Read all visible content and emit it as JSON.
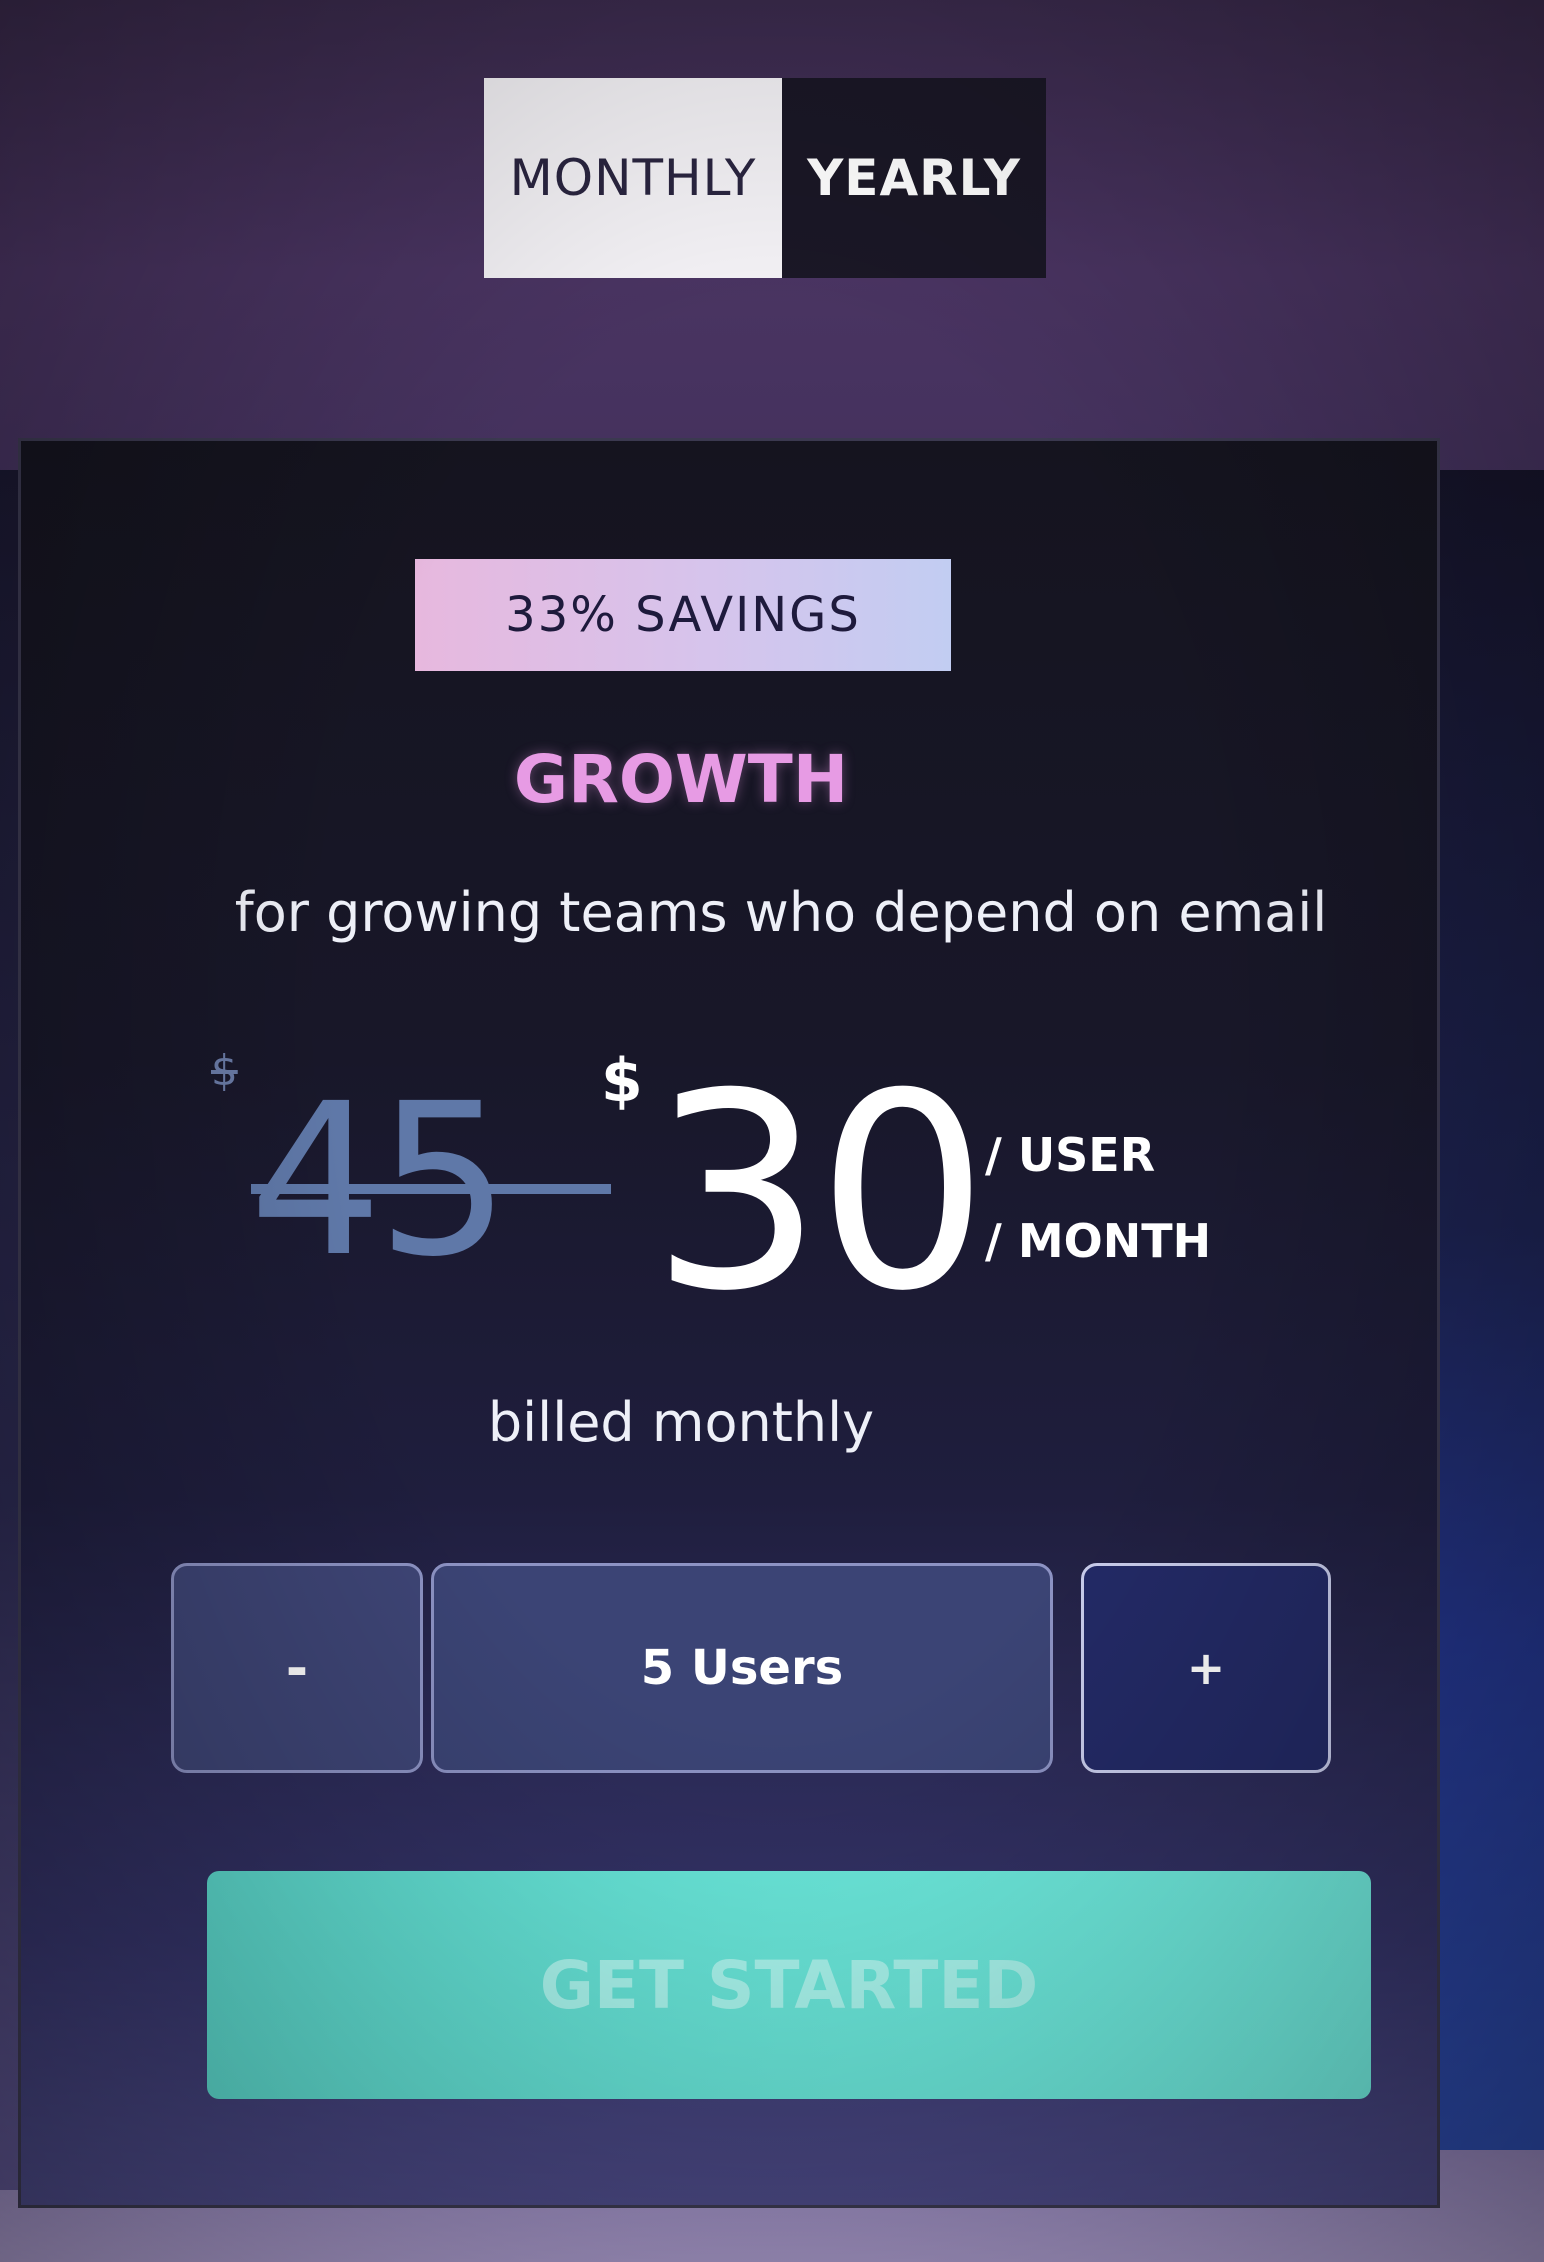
{
  "billing_toggle": {
    "monthly_label": "MONTHLY",
    "yearly_label": "YEARLY",
    "selected": "MONTHLY"
  },
  "plan": {
    "badge": "33% SAVINGS",
    "name": "GROWTH",
    "description": "for growing teams who depend on email",
    "old_currency": "$",
    "old_price": "45",
    "currency": "$",
    "price": "30",
    "per_user": "/ USER",
    "per_month": "/ MONTH",
    "billing_note": "billed monthly"
  },
  "users_stepper": {
    "decrement_label": "-",
    "value": "5 Users",
    "increment_label": "+"
  },
  "cta": {
    "label": "GET STARTED"
  },
  "colors": {
    "plan_name": "#e79be4",
    "cta_bg": "#6ae8db",
    "badge_gradient_start": "#e7b8de",
    "badge_gradient_end": "#c2cdf2"
  }
}
